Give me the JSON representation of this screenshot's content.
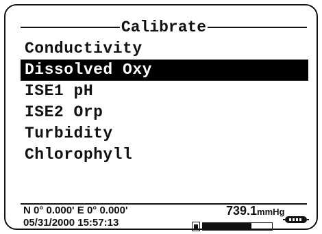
{
  "menu": {
    "title": "Calibrate",
    "items": [
      {
        "label": "Conductivity",
        "selected": false
      },
      {
        "label": "Dissolved Oxy",
        "selected": true
      },
      {
        "label": "ISE1 pH",
        "selected": false
      },
      {
        "label": "ISE2 Orp",
        "selected": false
      },
      {
        "label": "Turbidity",
        "selected": false
      },
      {
        "label": "Chlorophyll",
        "selected": false
      }
    ]
  },
  "status": {
    "gps": "N 0° 0.000' E  0° 0.000'",
    "datetime": "05/31/2000 15:57:13",
    "pressure_value": "739.1",
    "pressure_unit": "mmHg",
    "battery_level": 0.7
  }
}
